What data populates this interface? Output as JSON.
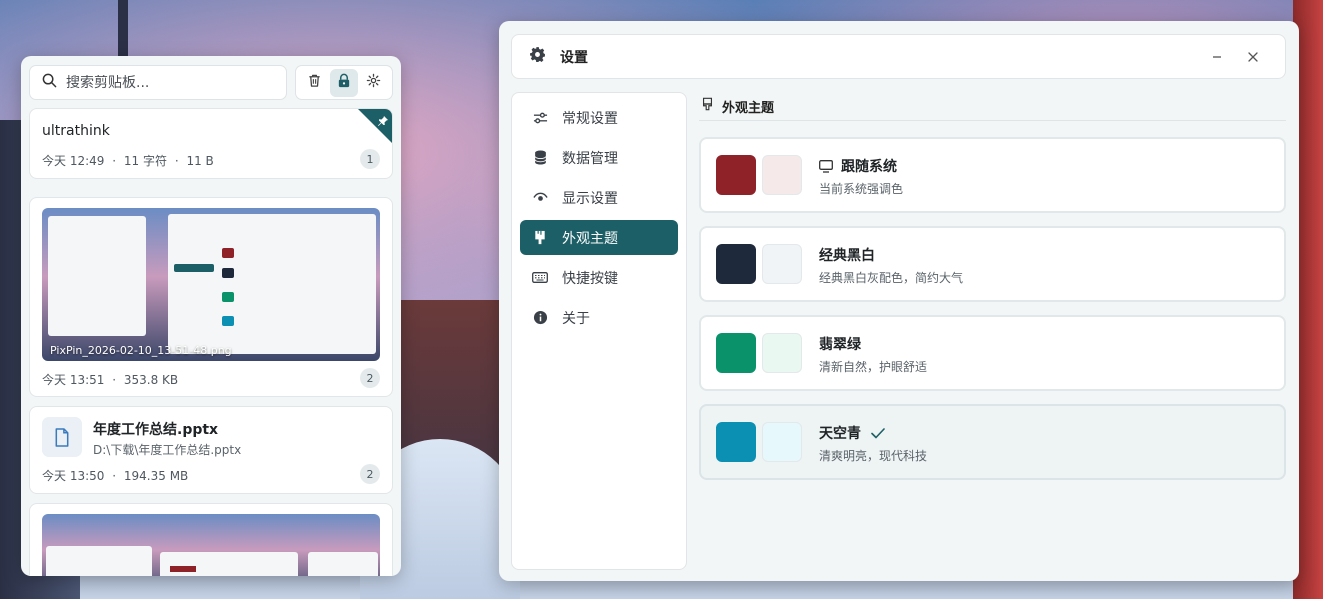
{
  "clipboard": {
    "search_placeholder": "搜索剪贴板...",
    "items": [
      {
        "text": "ultrathink",
        "time": "今天 12:49",
        "chars": "11 字符",
        "size": "11 B",
        "count": "1",
        "pinned": true
      },
      {
        "caption": "PixPin_2026-02-10_13-51-48.png",
        "time": "今天 13:51",
        "size": "353.8 KB",
        "count": "2"
      },
      {
        "name": "年度工作总结.pptx",
        "path": "D:\\下载\\年度工作总结.pptx",
        "time": "今天 13:50",
        "size": "194.35 MB",
        "count": "2"
      }
    ],
    "separator": "·"
  },
  "settings": {
    "title": "设置",
    "nav": [
      {
        "label": "常规设置",
        "icon": "sliders-icon"
      },
      {
        "label": "数据管理",
        "icon": "database-icon"
      },
      {
        "label": "显示设置",
        "icon": "eye-icon"
      },
      {
        "label": "外观主题",
        "icon": "brush-icon",
        "active": true
      },
      {
        "label": "快捷按键",
        "icon": "keyboard-icon"
      },
      {
        "label": "关于",
        "icon": "info-icon"
      }
    ],
    "section_title": "外观主题",
    "themes": [
      {
        "name": "跟随系统",
        "desc": "当前系统强调色",
        "primary": "#8f2128",
        "light": "#f5e9ea"
      },
      {
        "name": "经典黑白",
        "desc": "经典黑白灰配色，简约大气",
        "primary": "#1e293b",
        "light": "#f1f4f7"
      },
      {
        "name": "翡翠绿",
        "desc": "清新自然，护眼舒适",
        "primary": "#0a936a",
        "light": "#e9f8f1"
      },
      {
        "name": "天空青",
        "desc": "清爽明亮，现代科技",
        "primary": "#0b8fb3",
        "light": "#e6f8fb",
        "selected": true
      }
    ]
  },
  "colors": {
    "accent": "#1d5f66"
  }
}
